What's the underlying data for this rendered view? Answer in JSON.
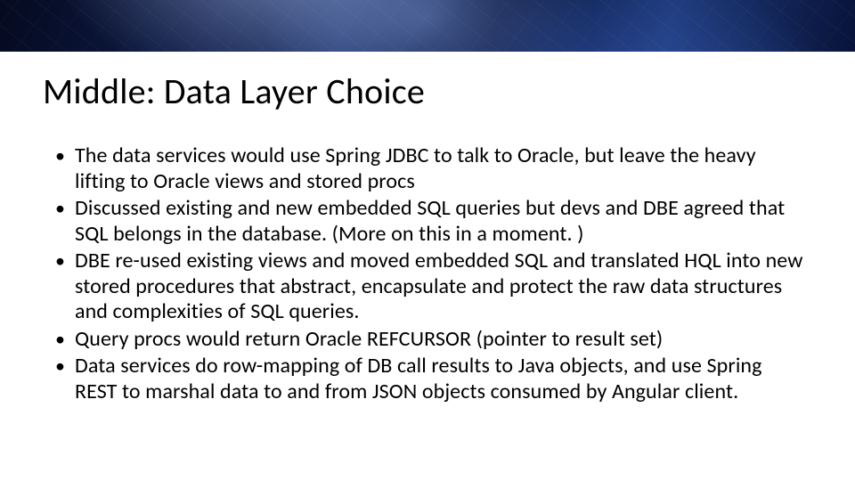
{
  "slide": {
    "title": "Middle: Data Layer Choice",
    "bullets": [
      "The data services would use Spring JDBC to talk to Oracle, but leave the heavy lifting to Oracle views and stored procs",
      "Discussed existing and new embedded SQL queries but devs and DBE agreed that SQL belongs in the database. (More on this in a moment. )",
      "DBE re-used existing views and moved embedded SQL and translated HQL into new stored procedures that abstract, encapsulate and protect the raw data structures and complexities of SQL queries.",
      "Query procs would return Oracle REFCURSOR (pointer to result set)",
      "Data services do row-mapping of DB call results to Java objects, and use Spring REST to marshal data to and from JSON objects consumed by Angular client."
    ]
  }
}
